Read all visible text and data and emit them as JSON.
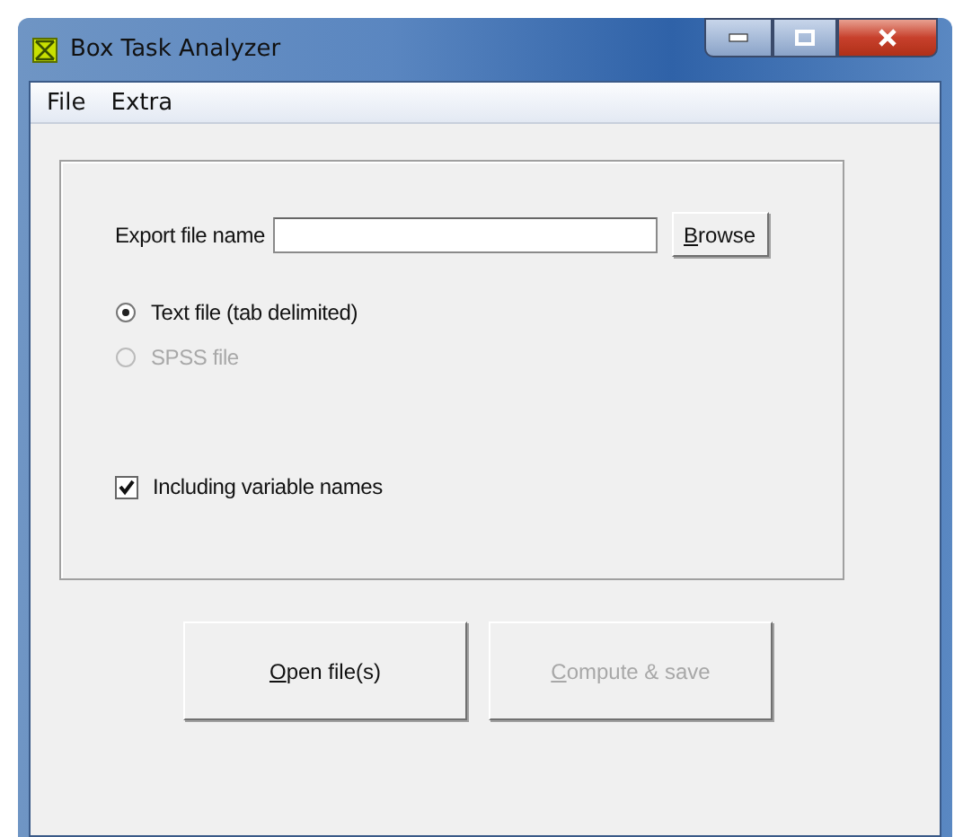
{
  "window": {
    "title": "Box Task Analyzer"
  },
  "menu": [
    "File",
    "Extra"
  ],
  "export": {
    "label": "Export file name",
    "button": {
      "label": "Browse",
      "mnemonic": true
    }
  },
  "formats": [
    {
      "label": "Text file (tab delimited)",
      "selected": true,
      "disabled": false
    },
    {
      "label": "SPSS file",
      "selected": false,
      "disabled": true
    }
  ],
  "include_names": {
    "label": "Including variable names",
    "checked": true
  },
  "buttons": [
    {
      "label": "Open file(s)",
      "mnemonic": true,
      "disabled": false
    },
    {
      "label": "Compute & save",
      "mnemonic": true,
      "disabled": true
    }
  ]
}
